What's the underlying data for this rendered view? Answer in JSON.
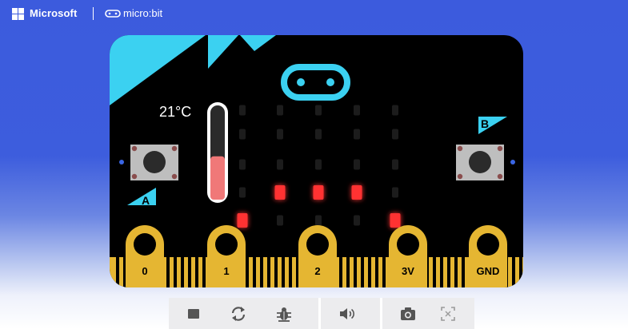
{
  "header": {
    "brand": "Microsoft",
    "product": "micro:bit"
  },
  "board": {
    "temperature": "21°C",
    "temperature_level": 0.46,
    "button_a": "A",
    "button_b": "B",
    "pins": [
      "0",
      "1",
      "2",
      "3V",
      "GND"
    ],
    "led_rows": [
      [
        0,
        0,
        0,
        0,
        0
      ],
      [
        0,
        0,
        0,
        0,
        0
      ],
      [
        0,
        0,
        0,
        0,
        0
      ],
      [
        0,
        1,
        1,
        1,
        0
      ],
      [
        1,
        0,
        0,
        0,
        1
      ]
    ]
  },
  "colors": {
    "background": "#3d5ddd",
    "board": "#000000",
    "accent": "#3bd1f1",
    "gold": "#e5b632",
    "led_on": "#ff3333",
    "led_off": "#1c1c1c",
    "thermometer_fill": "#f07878"
  },
  "toolbar": {
    "items": [
      {
        "icon": "stop-icon",
        "action": "stop"
      },
      {
        "icon": "restart-icon",
        "action": "restart"
      },
      {
        "icon": "debug-icon",
        "action": "debug"
      },
      {
        "icon": "sound-icon",
        "action": "mute"
      },
      {
        "icon": "screenshot-icon",
        "action": "screenshot"
      },
      {
        "icon": "fullscreen-icon",
        "action": "fullscreen"
      }
    ]
  }
}
